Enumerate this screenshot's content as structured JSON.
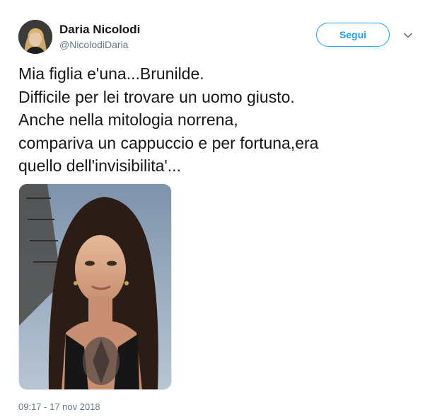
{
  "author": {
    "display_name": "Daria Nicolodi",
    "handle": "@NicolodiDaria",
    "avatar_icon": "profile-photo"
  },
  "follow_button": {
    "label": "Segui",
    "color": "#1da1f2"
  },
  "menu": {
    "icon": "chevron-down-icon"
  },
  "tweet": {
    "text": "Mia figlia e'una...Brunilde.\nDifficile per lei trovare un uomo giusto.\nAnche nella mitologia norrena,\ncompariva un cappuccio e per fortuna,era\nquello dell'invisibilita'...",
    "timestamp": "09:17 - 17 nov 2018"
  },
  "media": {
    "kind": "photo"
  },
  "colors": {
    "text": "#14171a",
    "secondary": "#657786",
    "accent": "#1da1f2",
    "border": "#e6ecf0"
  }
}
